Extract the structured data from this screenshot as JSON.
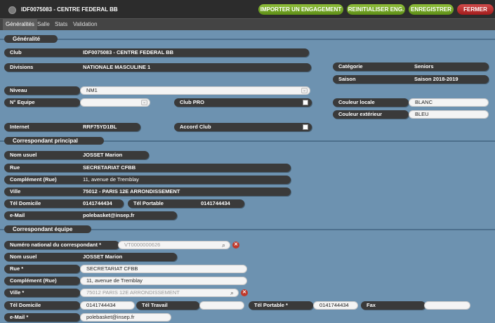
{
  "window": {
    "title": "IDF0075083 - CENTRE FEDERAL BB"
  },
  "toolbar": {
    "import_label": "IMPORTER UN ENGAGEMENT",
    "reset_label": "REINITIALISER ENG.",
    "save_label": "ENREGISTRER",
    "close_label": "FERMER"
  },
  "tabs": [
    "Généralités",
    "Salle",
    "Stats",
    "Validation"
  ],
  "sections": {
    "general": "Généralité",
    "principal": "Correspondant principal",
    "equipe": "Correspondant équipe"
  },
  "general": {
    "club_label": "Club",
    "club_value": "IDF0075083 - CENTRE FEDERAL BB",
    "divisions_label": "Divisions",
    "divisions_value": "NATIONALE MASCULINE 1",
    "categorie_label": "Catégorie",
    "categorie_value": "Seniors",
    "saison_label": "Saison",
    "saison_value": "Saison 2018-2019",
    "niveau_label": "Niveau",
    "niveau_value": "NM1",
    "equipe_label": "N° Equipe",
    "equipe_value": "",
    "clubpro_label": "Club PRO",
    "couleur_locale_label": "Couleur locale",
    "couleur_locale_value": "BLANC",
    "couleur_ext_label": "Couleur extérieur",
    "couleur_ext_value": "BLEU",
    "internet_label": "Internet",
    "internet_value": "RRF75YD1BL",
    "accord_label": "Accord Club"
  },
  "principal": {
    "nom_label": "Nom usuel",
    "nom_value": "JOSSET Marion",
    "rue_label": "Rue",
    "rue_value": "SECRETARIAT CFBB",
    "comp_label": "Complément (Rue)",
    "comp_value": "11, avenue de Tremblay",
    "ville_label": "Ville",
    "ville_value": "75012 - PARIS 12E ARRONDISSEMENT",
    "teldom_label": "Tél Domicile",
    "teldom_value": "0141744434",
    "telport_label": "Tél Portable",
    "telport_value": "0141744434",
    "email_label": "e-Mail",
    "email_value": "polebasket@insep.fr"
  },
  "equipe": {
    "numero_label": "Numéro national du correspondant *",
    "numero_value": "VT0000000626",
    "nom_label": "Nom usuel",
    "nom_value": "JOSSET Marion",
    "rue_label": "Rue *",
    "rue_value": "SECRETARIAT CFBB",
    "comp_label": "Complément (Rue)",
    "comp_value": "11, avenue de Tremblay",
    "ville_label": "Ville *",
    "ville_value": "75012 PARIS 12E ARRONDISSEMENT",
    "teldom_label": "Tél Domicile",
    "teldom_value": "0141744434",
    "teltrav_label": "Tél Travail",
    "teltrav_value": "",
    "telport_label": "Tél Portable *",
    "telport_value": "0141744434",
    "fax_label": "Fax",
    "fax_value": "",
    "email_label": "e-Mail *",
    "email_value": "polebasket@insep.fr"
  }
}
